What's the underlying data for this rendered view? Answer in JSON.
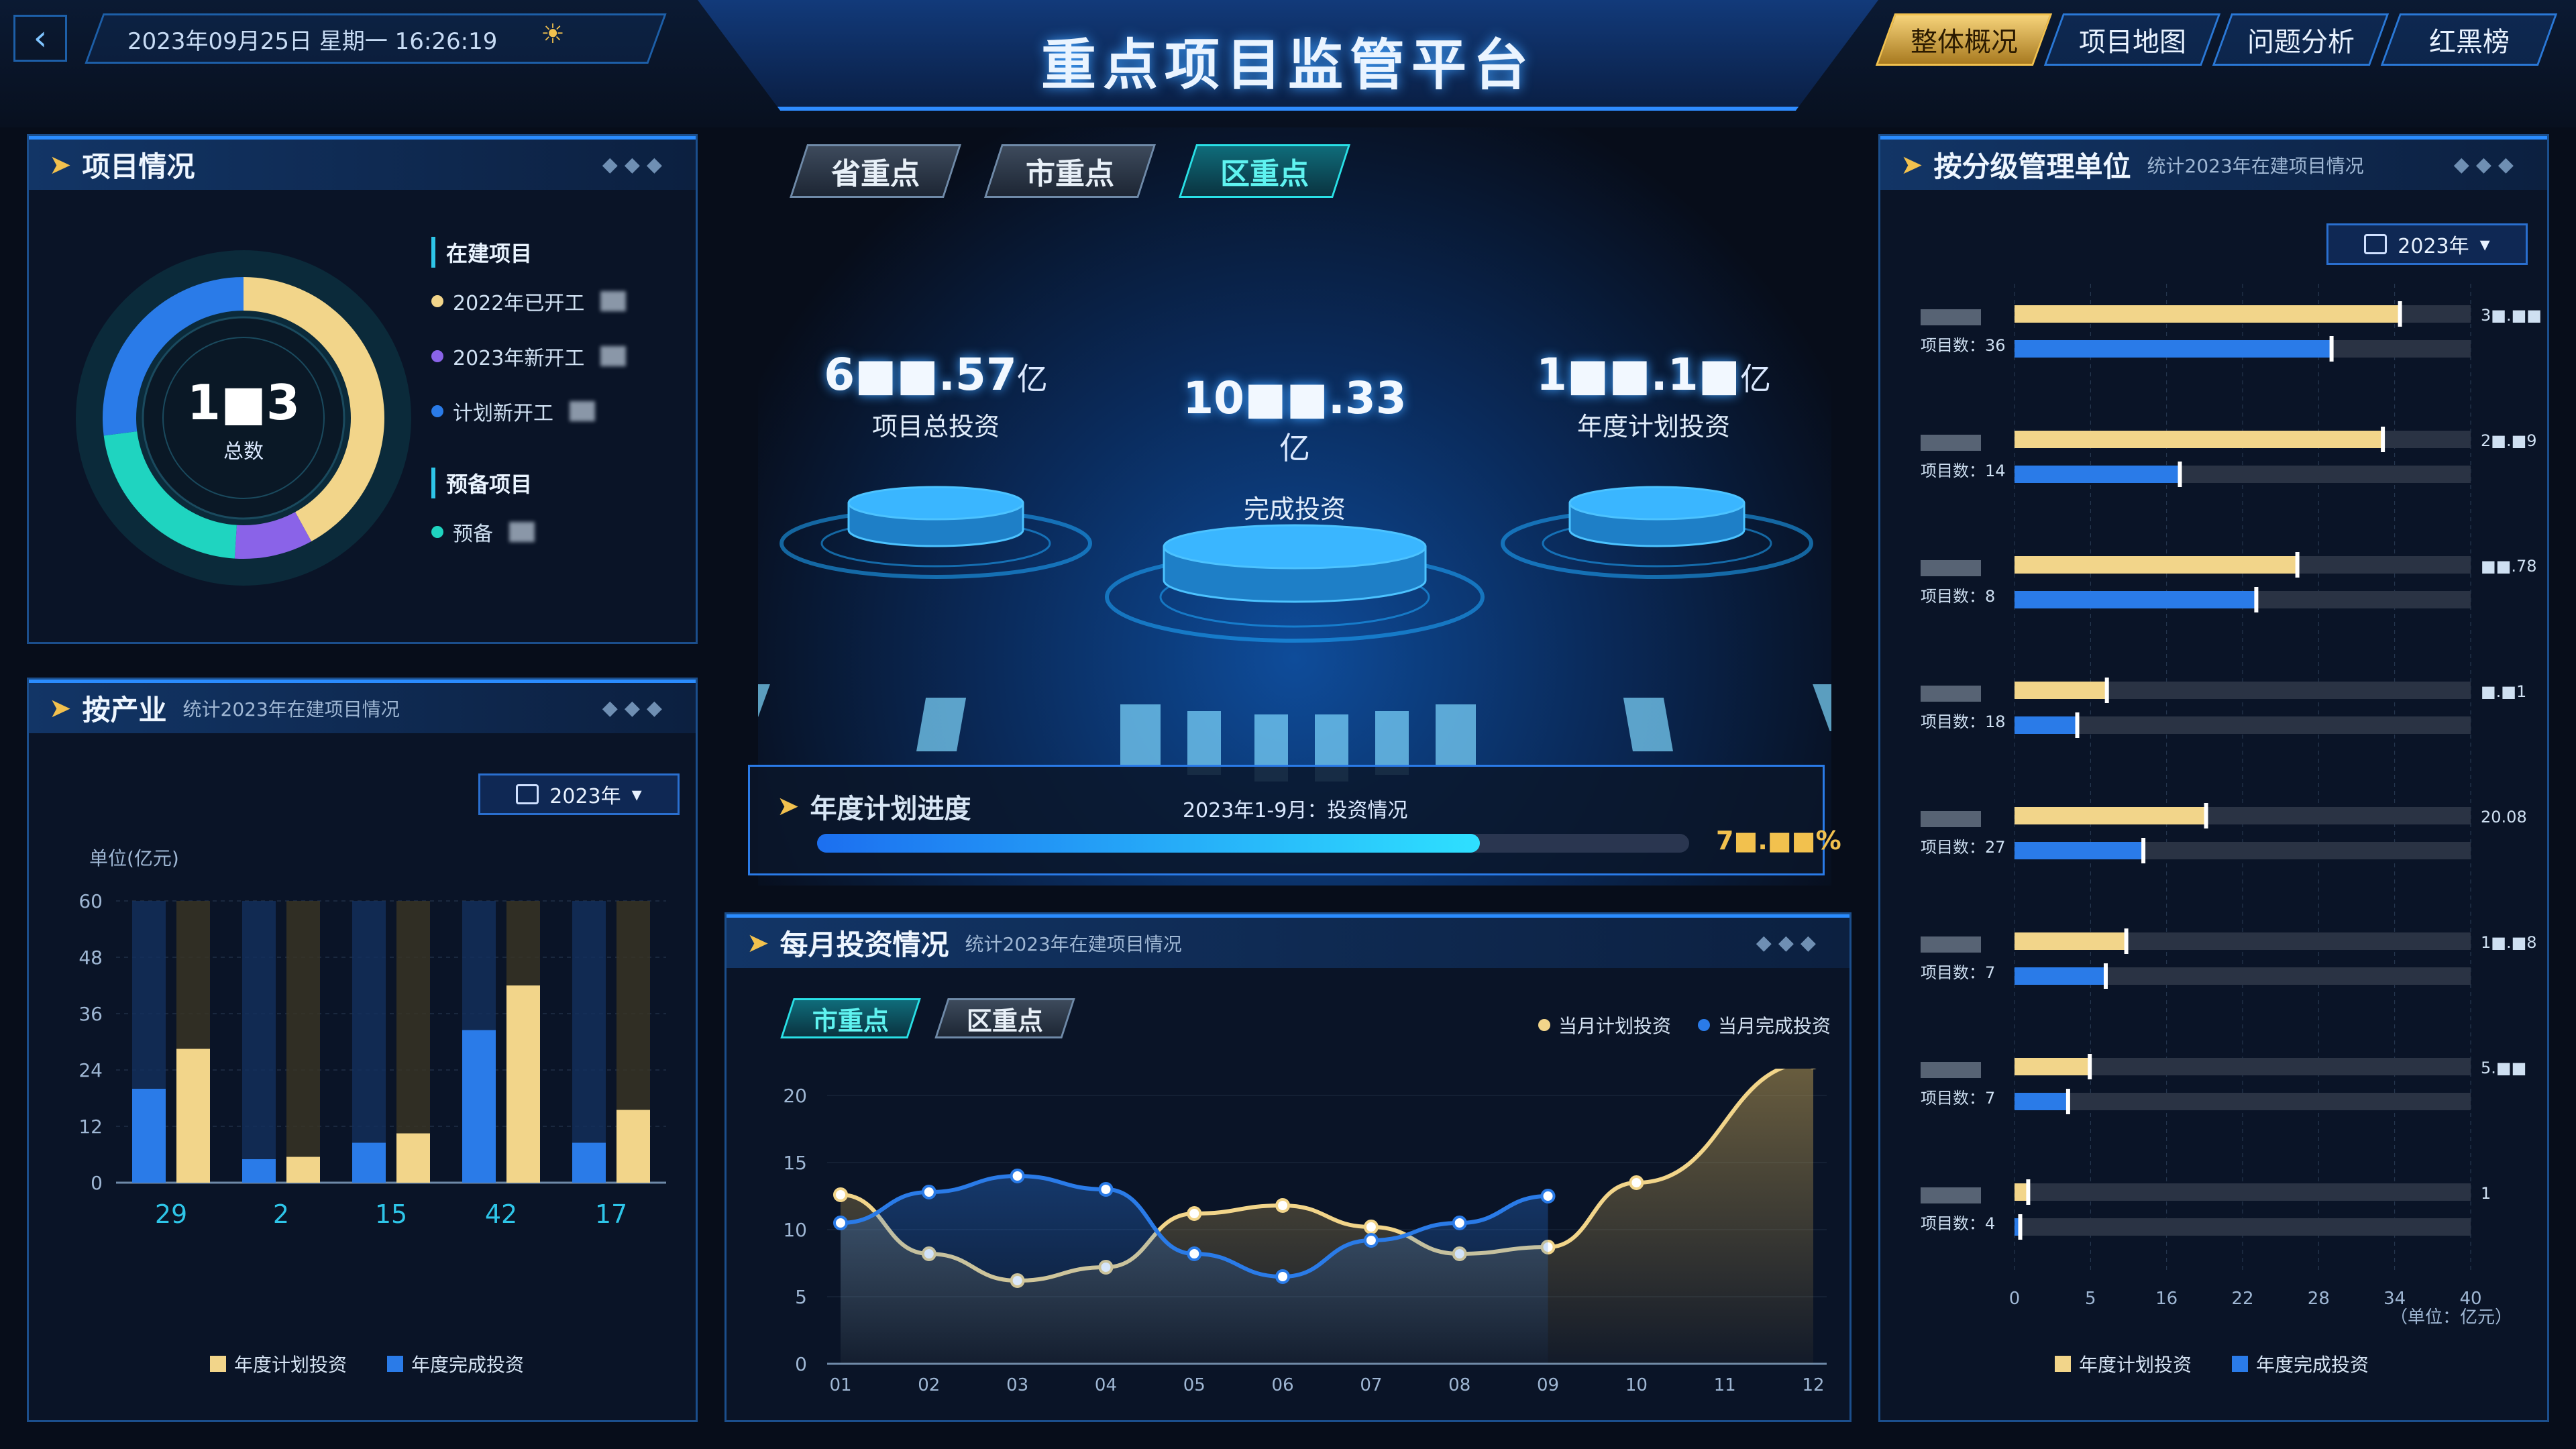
{
  "header": {
    "datetime": "2023年09月25日  星期一  16:26:19",
    "title": "重点项目监管平台",
    "tabs": [
      {
        "label": "整体概况"
      },
      {
        "label": "项目地图"
      },
      {
        "label": "问题分析"
      },
      {
        "label": "红黑榜"
      }
    ]
  },
  "project_panel": {
    "title": "项目情况",
    "total_label": "总数",
    "total_value": "1■3",
    "in_construction": "在建项目",
    "items": [
      {
        "label": "2022年已开工",
        "color": "#f2d58a"
      },
      {
        "label": "2023年新开工",
        "color": "#8a63e8"
      },
      {
        "label": "计划新开工",
        "color": "#2a7be8"
      }
    ],
    "reserve": "预备项目",
    "reserve_items": [
      {
        "label": "预备",
        "color": "#1fd4c0"
      }
    ],
    "donut_fractions": [
      0.42,
      0.09,
      0.22,
      0.27
    ],
    "donut_colors": [
      "#f2d58a",
      "#8a63e8",
      "#1fd4c0",
      "#2a7be8"
    ]
  },
  "industry_panel": {
    "title": "按产业",
    "subtitle": "统计2023年在建项目情况",
    "year": "2023年",
    "unit": "单位(亿元)",
    "legend_plan": "年度计划投资",
    "legend_done": "年度完成投资"
  },
  "center": {
    "levels": [
      {
        "label": "省重点"
      },
      {
        "label": "市重点"
      },
      {
        "label": "区重点"
      }
    ],
    "metrics": [
      {
        "value": "6■■.57",
        "unit": "亿",
        "label": "项目总投资"
      },
      {
        "value": "10■■.33",
        "unit": "亿",
        "label": "完成投资"
      },
      {
        "value": "1■■.1■",
        "unit": "亿",
        "label": "年度计划投资"
      }
    ],
    "progress": {
      "title": "年度计划进度",
      "subtitle": "2023年1-9月：投资情况",
      "value": "7■.■■%",
      "fraction": 0.76
    }
  },
  "monthly": {
    "title": "每月投资情况",
    "subtitle": "统计2023年在建项目情况",
    "tabs": [
      {
        "label": "市重点"
      },
      {
        "label": "区重点"
      }
    ],
    "legend_plan": "当月计划投资",
    "legend_done": "当月完成投资"
  },
  "unit_panel": {
    "title": "按分级管理单位",
    "subtitle": "统计2023年在建项目情况",
    "year": "2023年",
    "unit_note": "（单位：亿元）",
    "legend_plan": "年度计划投资",
    "legend_done": "年度完成投资"
  },
  "chart_data": [
    {
      "type": "bar",
      "title": "按产业",
      "ylabel": "单位(亿元)",
      "ylim": [
        0,
        60
      ],
      "yticks": [
        0,
        12,
        24,
        36,
        48,
        60
      ],
      "categories": [
        "29",
        "2",
        "15",
        "42",
        "17"
      ],
      "series": [
        {
          "name": "年度计划投资",
          "values": [
            28.5,
            5.5,
            10.5,
            42,
            15.5
          ],
          "color": "#f2d58a"
        },
        {
          "name": "年度完成投资",
          "values": [
            20,
            5,
            8.5,
            32.5,
            8.5
          ],
          "color": "#2a7be8"
        }
      ]
    },
    {
      "type": "line",
      "title": "每月投资情况",
      "x": [
        "01",
        "02",
        "03",
        "04",
        "05",
        "06",
        "07",
        "08",
        "09",
        "10",
        "11",
        "12"
      ],
      "ylim": [
        0,
        20
      ],
      "yticks": [
        0,
        5,
        10,
        15,
        20
      ],
      "series": [
        {
          "name": "当月计划投资",
          "values": [
            12.6,
            8.2,
            6.2,
            7.2,
            11.2,
            11.8,
            10.2,
            8.2,
            8.7,
            13.5,
            null,
            22.5
          ],
          "color": "#f2d58a"
        },
        {
          "name": "当月完成投资",
          "values": [
            10.5,
            12.8,
            14.0,
            13.0,
            8.2,
            6.5,
            9.2,
            10.5,
            12.5,
            null,
            null,
            null
          ],
          "color": "#2a7be8"
        }
      ]
    },
    {
      "type": "bar",
      "title": "按分级管理单位",
      "orientation": "horizontal",
      "xlim": [
        0,
        40
      ],
      "xticks": [
        0,
        5,
        16,
        22,
        28,
        34,
        40
      ],
      "counts": [
        "项目数：36",
        "项目数：14",
        "项目数：8",
        "项目数：18",
        "项目数：27",
        "项目数：7",
        "项目数：7",
        "项目数：4"
      ],
      "series": [
        {
          "name": "年度计划投资",
          "values": [
            33.8,
            32.3,
            24.8,
            8.1,
            16.8,
            9.8,
            6.6,
            1.2
          ],
          "color": "#f2d58a"
        },
        {
          "name": "年度完成投资",
          "values": [
            27.8,
            14.5,
            21.2,
            5.5,
            11.3,
            8.0,
            4.7,
            0.5
          ],
          "color": "#2a7be8"
        }
      ],
      "value_labels": [
        "3■.■■",
        "2■.■9",
        "■■.78",
        "■.■1",
        "20.08",
        "1■.■8",
        "5.■■",
        "1"
      ]
    }
  ]
}
